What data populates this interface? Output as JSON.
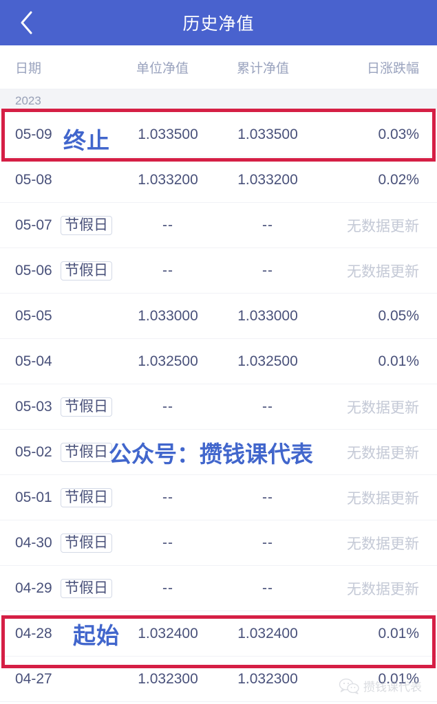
{
  "header": {
    "title": "历史净值",
    "back_icon": "chevron-left-icon"
  },
  "table": {
    "columns": {
      "date": "日期",
      "unit_nav": "单位净值",
      "accum_nav": "累计净值",
      "daily_change": "日涨跌幅"
    },
    "year_group": "2023",
    "holiday_badge": "节假日",
    "empty_value": "--",
    "no_update_text": "无数据更新",
    "rows": [
      {
        "date": "05-09",
        "holiday": false,
        "unit_nav": "1.033500",
        "accum_nav": "1.033500",
        "change": "0.03%",
        "highlighted": true
      },
      {
        "date": "05-08",
        "holiday": false,
        "unit_nav": "1.033200",
        "accum_nav": "1.033200",
        "change": "0.02%",
        "highlighted": false
      },
      {
        "date": "05-07",
        "holiday": true,
        "unit_nav": "--",
        "accum_nav": "--",
        "change": "无数据更新",
        "highlighted": false
      },
      {
        "date": "05-06",
        "holiday": true,
        "unit_nav": "--",
        "accum_nav": "--",
        "change": "无数据更新",
        "highlighted": false
      },
      {
        "date": "05-05",
        "holiday": false,
        "unit_nav": "1.033000",
        "accum_nav": "1.033000",
        "change": "0.05%",
        "highlighted": false
      },
      {
        "date": "05-04",
        "holiday": false,
        "unit_nav": "1.032500",
        "accum_nav": "1.032500",
        "change": "0.01%",
        "highlighted": false
      },
      {
        "date": "05-03",
        "holiday": true,
        "unit_nav": "--",
        "accum_nav": "--",
        "change": "无数据更新",
        "highlighted": false
      },
      {
        "date": "05-02",
        "holiday": true,
        "unit_nav": "--",
        "accum_nav": "--",
        "change": "无数据更新",
        "highlighted": false
      },
      {
        "date": "05-01",
        "holiday": true,
        "unit_nav": "--",
        "accum_nav": "--",
        "change": "无数据更新",
        "highlighted": false
      },
      {
        "date": "04-30",
        "holiday": true,
        "unit_nav": "--",
        "accum_nav": "--",
        "change": "无数据更新",
        "highlighted": false
      },
      {
        "date": "04-29",
        "holiday": true,
        "unit_nav": "--",
        "accum_nav": "--",
        "change": "无数据更新",
        "highlighted": false
      },
      {
        "date": "04-28",
        "holiday": false,
        "unit_nav": "1.032400",
        "accum_nav": "1.032400",
        "change": "0.01%",
        "highlighted": true
      },
      {
        "date": "04-27",
        "holiday": false,
        "unit_nav": "1.032300",
        "accum_nav": "1.032300",
        "change": "0.01%",
        "highlighted": false
      }
    ]
  },
  "annotations": {
    "end_label": "终止",
    "start_label": "起始",
    "promo_text": "公众号：攒钱课代表"
  },
  "watermark": {
    "icon": "wechat-icon",
    "text": "攒钱课代表"
  },
  "colors": {
    "nav_blue": "#4962CE",
    "highlight_red": "#D51F45",
    "change_red": "#E8655C",
    "annotation_blue": "#4166CC",
    "muted_gray": "#9AA3BE"
  }
}
